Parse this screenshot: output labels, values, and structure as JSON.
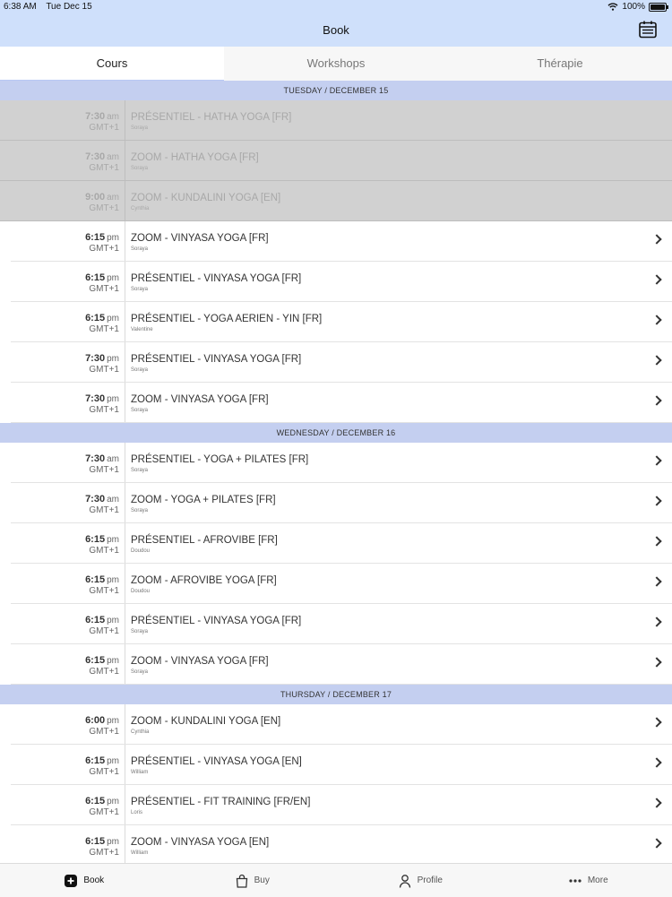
{
  "status_bar": {
    "time": "6:38 AM",
    "date": "Tue Dec 15",
    "battery": "100%",
    "battery_level": 1.0
  },
  "header": {
    "title": "Book",
    "calendar_icon": "calendar-icon"
  },
  "tabs": [
    {
      "label": "Cours",
      "active": true
    },
    {
      "label": "Workshops",
      "active": false
    },
    {
      "label": "Thérapie",
      "active": false
    }
  ],
  "sections": [
    {
      "title": "TUESDAY / DECEMBER 15",
      "rows": [
        {
          "time": "7:30",
          "ampm": "am",
          "tz": "GMT+1",
          "name": "PRÉSENTIEL - HATHA YOGA [FR]",
          "teacher": "Soraya",
          "past": true
        },
        {
          "time": "7:30",
          "ampm": "am",
          "tz": "GMT+1",
          "name": "ZOOM - HATHA YOGA [FR]",
          "teacher": "Soraya",
          "past": true
        },
        {
          "time": "9:00",
          "ampm": "am",
          "tz": "GMT+1",
          "name": "ZOOM - KUNDALINI YOGA [EN]",
          "teacher": "Cynthia",
          "past": true
        },
        {
          "time": "6:15",
          "ampm": "pm",
          "tz": "GMT+1",
          "name": "ZOOM - VINYASA YOGA [FR]",
          "teacher": "Soraya",
          "past": false
        },
        {
          "time": "6:15",
          "ampm": "pm",
          "tz": "GMT+1",
          "name": "PRÉSENTIEL - VINYASA YOGA [FR]",
          "teacher": "Soraya",
          "past": false
        },
        {
          "time": "6:15",
          "ampm": "pm",
          "tz": "GMT+1",
          "name": "PRÉSENTIEL - YOGA AERIEN - YIN [FR]",
          "teacher": "Valentine",
          "past": false
        },
        {
          "time": "7:30",
          "ampm": "pm",
          "tz": "GMT+1",
          "name": "PRÉSENTIEL - VINYASA YOGA [FR]",
          "teacher": "Soraya",
          "past": false
        },
        {
          "time": "7:30",
          "ampm": "pm",
          "tz": "GMT+1",
          "name": "ZOOM - VINYASA YOGA [FR]",
          "teacher": "Soraya",
          "past": false
        }
      ]
    },
    {
      "title": "WEDNESDAY / DECEMBER 16",
      "rows": [
        {
          "time": "7:30",
          "ampm": "am",
          "tz": "GMT+1",
          "name": "PRÉSENTIEL - YOGA + PILATES [FR]",
          "teacher": "Soraya",
          "past": false
        },
        {
          "time": "7:30",
          "ampm": "am",
          "tz": "GMT+1",
          "name": "ZOOM - YOGA + PILATES [FR]",
          "teacher": "Soraya",
          "past": false
        },
        {
          "time": "6:15",
          "ampm": "pm",
          "tz": "GMT+1",
          "name": "PRÉSENTIEL - AFROVIBE [FR]",
          "teacher": "Doudou",
          "past": false
        },
        {
          "time": "6:15",
          "ampm": "pm",
          "tz": "GMT+1",
          "name": "ZOOM - AFROVIBE YOGA [FR]",
          "teacher": "Doudou",
          "past": false
        },
        {
          "time": "6:15",
          "ampm": "pm",
          "tz": "GMT+1",
          "name": "PRÉSENTIEL - VINYASA YOGA [FR]",
          "teacher": "Soraya",
          "past": false
        },
        {
          "time": "6:15",
          "ampm": "pm",
          "tz": "GMT+1",
          "name": "ZOOM - VINYASA YOGA [FR]",
          "teacher": "Soraya",
          "past": false
        }
      ]
    },
    {
      "title": "THURSDAY / DECEMBER 17",
      "rows": [
        {
          "time": "6:00",
          "ampm": "pm",
          "tz": "GMT+1",
          "name": "ZOOM - KUNDALINI YOGA [EN]",
          "teacher": "Cynthia",
          "past": false
        },
        {
          "time": "6:15",
          "ampm": "pm",
          "tz": "GMT+1",
          "name": "PRÉSENTIEL - VINYASA YOGA [EN]",
          "teacher": "William",
          "past": false
        },
        {
          "time": "6:15",
          "ampm": "pm",
          "tz": "GMT+1",
          "name": "PRÉSENTIEL - FIT TRAINING [FR/EN]",
          "teacher": "Loris",
          "past": false
        },
        {
          "time": "6:15",
          "ampm": "pm",
          "tz": "GMT+1",
          "name": "ZOOM - VINYASA YOGA [EN]",
          "teacher": "William",
          "past": false
        }
      ]
    }
  ],
  "tabbar": [
    {
      "label": "Book",
      "icon": "plus-square-icon",
      "active": true
    },
    {
      "label": "Buy",
      "icon": "shopping-bag-icon",
      "active": false
    },
    {
      "label": "Profile",
      "icon": "person-icon",
      "active": false
    },
    {
      "label": "More",
      "icon": "ellipsis-icon",
      "active": false
    }
  ]
}
